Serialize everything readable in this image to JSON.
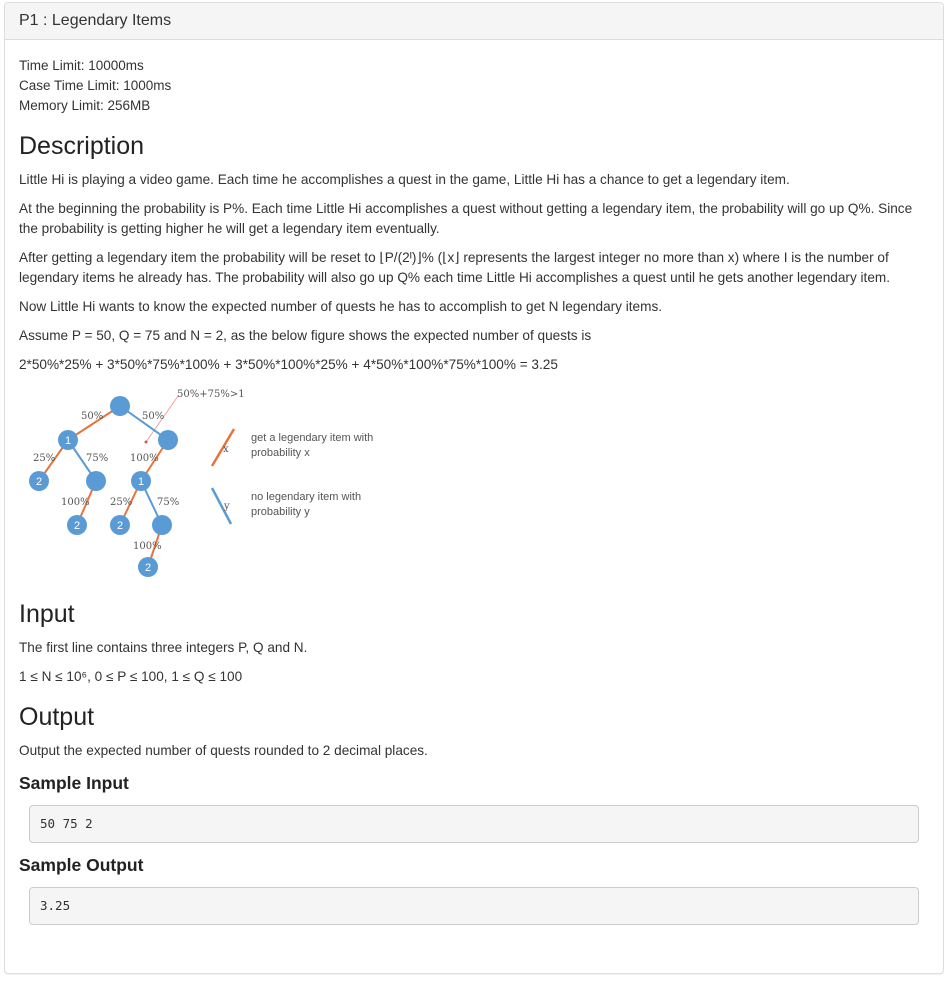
{
  "heading": {
    "title": "P1 : Legendary Items"
  },
  "limits": {
    "time": "Time Limit:  10000ms",
    "case_time": "Case Time Limit:  1000ms",
    "memory": "Memory Limit:  256MB"
  },
  "description": {
    "title": "Description",
    "p1": "Little Hi is playing a video game. Each time he accomplishes a quest in the game, Little Hi has a chance to get a legendary item.",
    "p2": "At the beginning the probability is P%. Each time Little Hi accomplishes a quest without getting a legendary item, the probability will go up Q%. Since the probability is getting higher he will get a legendary item eventually.",
    "p3": "After getting a legendary item the probability will be reset to ⌊P/(2ᴵ)⌋% (⌊x⌋ represents the largest integer no more than x) where I is the number of legendary items he already has. The probability will also go up Q% each time Little Hi accomplishes a quest until he gets another legendary item.",
    "p4": "Now Little Hi wants to know the expected number of quests he has to accomplish to get N legendary items.",
    "p5": "Assume P = 50, Q = 75 and N = 2, as the below figure shows the expected number of quests is",
    "formula": "2*50%*25% + 3*50%*75%*100% + 3*50%*100%*25% + 4*50%*100%*75%*100% = 3.25"
  },
  "figure": {
    "annotation": "50%+75%>1",
    "edge_labels": [
      "50%",
      "50%",
      "25%",
      "75%",
      "100%",
      "100%",
      "25%",
      "75%",
      "100%"
    ],
    "node_labels": [
      "1",
      "2",
      "1",
      "2",
      "2",
      "2"
    ],
    "legend_orange": "get a legendary item with probability x",
    "legend_orange_line1": "get a legendary item with",
    "legend_orange_line2": "probability x",
    "legend_orange_var": "x",
    "legend_blue_line1": "no legendary item with",
    "legend_blue_line2": "probability y",
    "legend_blue_var": "y",
    "orange": "#e8743b",
    "blue": "#5b9bd5"
  },
  "input": {
    "title": "Input",
    "p1": "The first line contains three integers P, Q and N.",
    "p2": "1 ≤ N ≤ 10⁶, 0 ≤ P ≤ 100, 1 ≤ Q ≤ 100"
  },
  "output": {
    "title": "Output",
    "p1": "Output the expected number of quests rounded to 2 decimal places."
  },
  "sample_input": {
    "title": "Sample Input",
    "value": "50 75 2"
  },
  "sample_output": {
    "title": "Sample Output",
    "value": "3.25"
  }
}
